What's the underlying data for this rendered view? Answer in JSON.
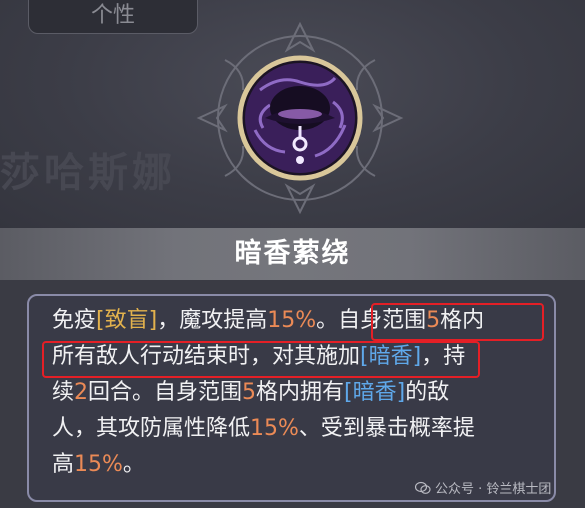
{
  "tab": {
    "label": "个性"
  },
  "background": {
    "ghost_text": "莎哈斯娜"
  },
  "skill": {
    "icon": "dark-fragrance-skill-icon",
    "name": "暗香萦绕",
    "description": {
      "line1": [
        "免疫",
        "[",
        "致盲",
        "]",
        "，魔攻提高",
        "15%",
        "。",
        "自身范围",
        "5",
        "格内"
      ],
      "line2": [
        "所有敌人行动结束时，对其施加",
        "[",
        "暗香",
        "]",
        "，持"
      ],
      "line3": [
        "续",
        "2",
        "回合。自身范围",
        "5",
        "格内拥有",
        "[",
        "暗香",
        "]",
        "的敌"
      ],
      "line4": [
        "人，其攻防属性降低",
        "15%",
        "、受到暴击概率提"
      ],
      "line5": [
        "高",
        "15%",
        "。"
      ]
    }
  },
  "watermark": {
    "text": "公众号 · 铃兰棋士团",
    "icon": "wechat-icon"
  },
  "colors": {
    "value_orange": "#eb8a56",
    "status_gold": "#e3b24d",
    "keyword_blue": "#5fa8ea",
    "highlight_red": "#e41f26"
  }
}
